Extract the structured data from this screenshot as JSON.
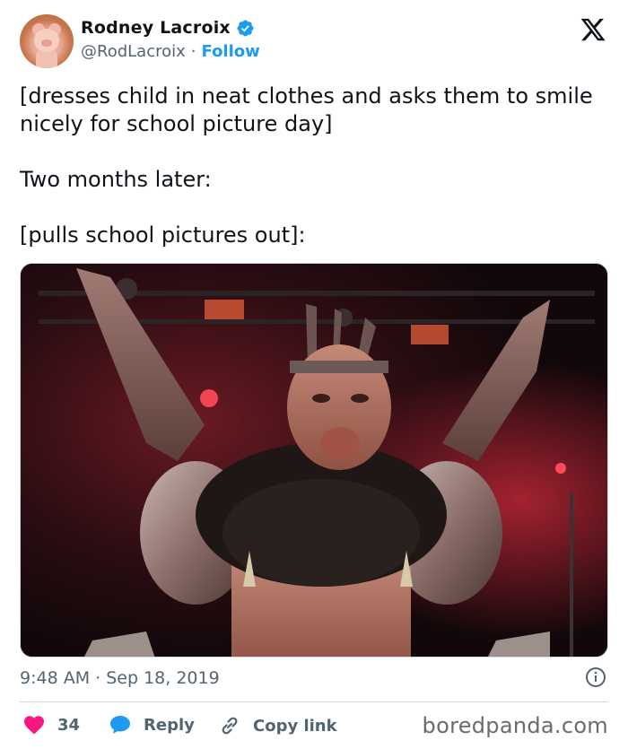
{
  "user": {
    "name": "Rodney Lacroix",
    "handle": "@RodLacroix",
    "separator": "·",
    "follow_label": "Follow"
  },
  "tweet": {
    "lines": [
      "[dresses child in neat clothes and asks them to smile nicely for school picture day]",
      "Two months later:",
      "[pulls school pictures out]:"
    ]
  },
  "meta": {
    "timestamp": "9:48 AM · Sep 18, 2019"
  },
  "actions": {
    "like_count": "34",
    "reply_label": "Reply",
    "copy_label": "Copy link"
  },
  "watermark": "boredpanda.com",
  "icons": {
    "logo": "x-logo-icon",
    "verified": "verified-badge-icon",
    "info": "info-icon",
    "like": "heart-icon",
    "reply": "speech-bubble-icon",
    "copy": "link-icon"
  },
  "colors": {
    "accent": "#1d9bf0",
    "like": "#f91880",
    "text": "#0f1419",
    "secondary": "#536471"
  }
}
